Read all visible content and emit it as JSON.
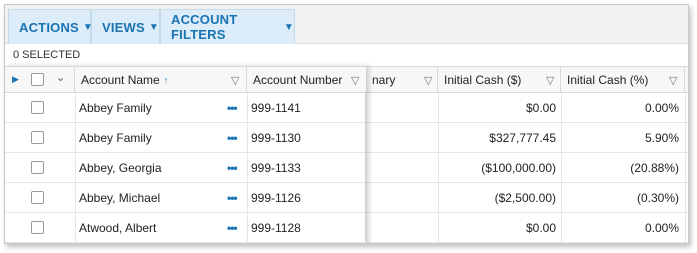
{
  "toolbar": {
    "actions_label": "ACTIONS",
    "views_label": "VIEWS",
    "filters_label": "ACCOUNT FILTERS"
  },
  "selection": {
    "count_text": "0 SELECTED"
  },
  "columns": {
    "account_name": "Account Name",
    "account_number": "Account Number",
    "summary_partial": "nary",
    "initial_cash": "Initial Cash ($)",
    "initial_cash_pct": "Initial Cash (%)"
  },
  "rows": [
    {
      "name": "Abbey Family",
      "number": "999-1141",
      "cash": "$0.00",
      "cash_pct": "0.00%"
    },
    {
      "name": "Abbey Family",
      "number": "999-1130",
      "cash": "$327,777.45",
      "cash_pct": "5.90%"
    },
    {
      "name": "Abbey, Georgia",
      "number": "999-1133",
      "cash": "($100,000.00)",
      "cash_pct": "(20.88%)"
    },
    {
      "name": "Abbey, Michael",
      "number": "999-1126",
      "cash": "($2,500.00)",
      "cash_pct": "(0.30%)"
    },
    {
      "name": "Atwood, Albert",
      "number": "999-1128",
      "cash": "$0.00",
      "cash_pct": "0.00%"
    }
  ],
  "icons": {
    "filter": "funnel-icon",
    "sort": "sort-ascending-icon",
    "more": "ellipsis-icon",
    "expand": "caret-right-icon",
    "chevron": "chevron-down-icon"
  }
}
